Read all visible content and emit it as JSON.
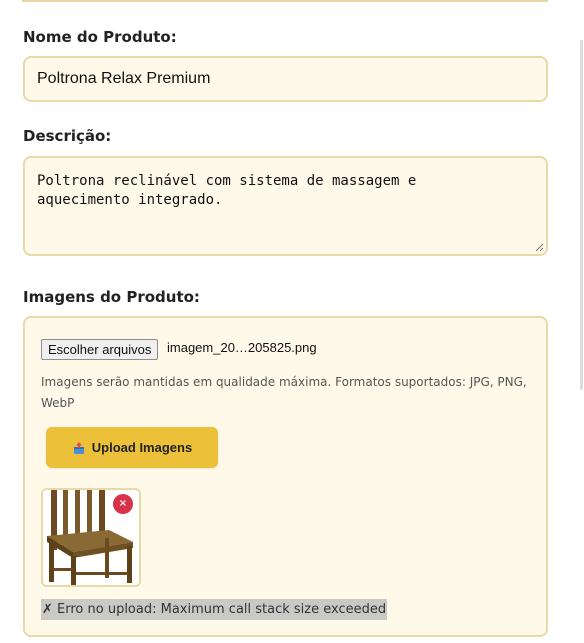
{
  "fields": {
    "name": {
      "label": "Nome do Produto:",
      "value": "Poltrona Relax Premium"
    },
    "description": {
      "label": "Descrição:",
      "value": "Poltrona reclinável com sistema de massagem e\naquecimento integrado."
    }
  },
  "images": {
    "label": "Imagens do Produto:",
    "choose_files_label": "Escolher arquivos",
    "selected_file": "imagem_20…205825.png",
    "help_text": "Imagens serão mantidas em qualidade máxima. Formatos suportados: JPG, PNG, WebP",
    "upload_button_label": "Upload Imagens",
    "upload_icon": "box-upload-icon",
    "thumbnail_icon": "wooden-chair-image",
    "remove_icon": "close-icon",
    "remove_symbol": "×",
    "error_message": "✗ Erro no upload: Maximum call stack size exceeded"
  },
  "colors": {
    "field_bg": "#fff9e9",
    "field_border": "#e8d9a9",
    "upload_button": "#ecc038",
    "remove_button": "#d9334b",
    "error_bg": "#c9c9c6"
  }
}
